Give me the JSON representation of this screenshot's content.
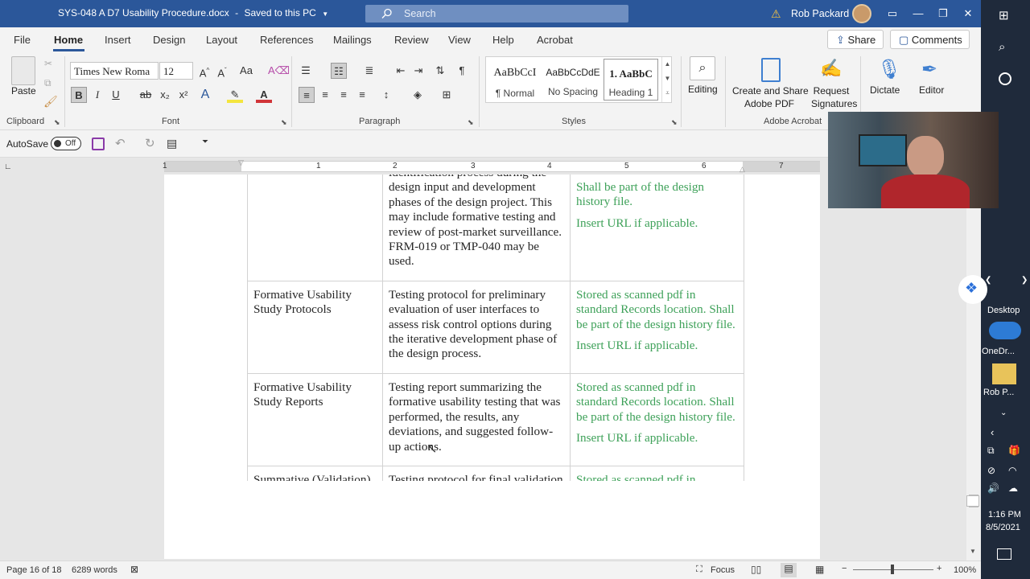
{
  "titlebar": {
    "doc_name": "SYS-048 A D7 Usability Procedure.docx",
    "save_status": "Saved to this PC",
    "search_placeholder": "Search",
    "user_name": "Rob Packard"
  },
  "tabs": [
    "File",
    "Home",
    "Insert",
    "Design",
    "Layout",
    "References",
    "Mailings",
    "Review",
    "View",
    "Help",
    "Acrobat"
  ],
  "share_label": "Share",
  "comments_label": "Comments",
  "ribbon": {
    "clipboard": {
      "paste": "Paste",
      "group": "Clipboard"
    },
    "font": {
      "name": "Times New Roma",
      "size": "12",
      "group": "Font"
    },
    "paragraph": {
      "group": "Paragraph"
    },
    "styles": {
      "group": "Styles",
      "items": [
        {
          "preview": "AaBbCcI",
          "name": "¶ Normal"
        },
        {
          "preview": "AaBbCcDdE",
          "name": "No Spacing"
        },
        {
          "preview": "1.  AaBbC",
          "name": "Heading 1"
        }
      ]
    },
    "editing": "Editing",
    "acrobat": {
      "create": "Create and Share",
      "create2": "Adobe PDF",
      "request": "Request",
      "request2": "Signatures",
      "group": "Adobe Acrobat"
    },
    "dictate": "Dictate",
    "editor": "Editor"
  },
  "qat": {
    "autosave": "AutoSave",
    "toggle": "Off"
  },
  "ruler": [
    "1",
    "1",
    "2",
    "3",
    "4",
    "5",
    "6",
    "7"
  ],
  "table": {
    "rows": [
      {
        "col1": "",
        "col2": "identification process during the design input and development phases of the design project. This may include formative testing and review of post-market surveillance. FRM-019 or TMP-040 may be used.",
        "col3a": "Shall be part of the design history file.",
        "col3b": "Insert URL if applicable."
      },
      {
        "col1": "Formative Usability Study Protocols",
        "col2": "Testing protocol for preliminary evaluation of user interfaces to assess risk control options during the iterative development phase of the design process.",
        "col3a": "Stored as scanned pdf in standard Records location. Shall be part of the design history file.",
        "col3b": "Insert URL if applicable."
      },
      {
        "col1": "Formative Usability Study Reports",
        "col2": "Testing report summarizing the formative usability testing that was performed, the results, any deviations, and suggested follow-up actions.",
        "col3a": "Stored as scanned pdf in standard Records location. Shall be part of the design history file.",
        "col3b": "Insert URL if applicable."
      },
      {
        "col1": "Summative (Validation) Usability",
        "col2": "Testing protocol for final validation of the user interfaces to",
        "col3a": "Stored as scanned pdf in standard Records location.",
        "col3b": ""
      }
    ]
  },
  "status": {
    "page": "Page 16 of 18",
    "words": "6289 words",
    "focus": "Focus",
    "zoom": "100%"
  },
  "taskbar": {
    "desktop": "Desktop",
    "onedrive": "OneDr...",
    "robp": "Rob P...",
    "time": "1:16 PM",
    "date": "8/5/2021"
  },
  "colors": {
    "brand": "#2b579a",
    "green_text": "#3ea159"
  }
}
